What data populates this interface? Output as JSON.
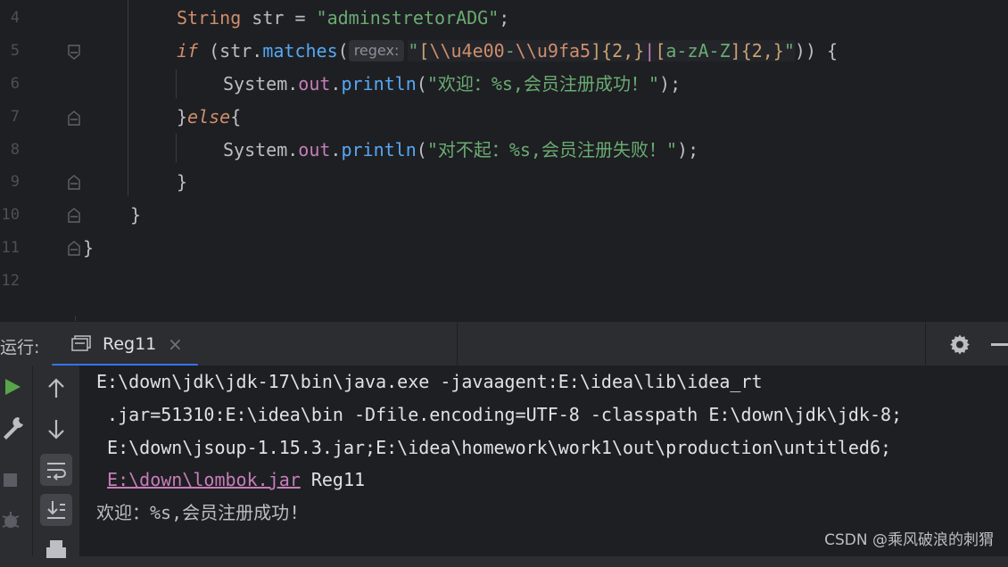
{
  "editor": {
    "line_numbers": [
      "4",
      "5",
      "6",
      "7",
      "8",
      "9",
      "10",
      "11",
      "12"
    ],
    "lines": {
      "l4": {
        "type": "String",
        "var": " str = ",
        "str": "\"adminstretorADG\"",
        "end": ";"
      },
      "l5": {
        "kw": "if",
        "open": " (str.",
        "fn": "matches",
        "paren": "(",
        "hint": "regex:",
        "q1": "\"",
        "b1": "[",
        "e1": "\\\\u4e00",
        "dash1": "-",
        "e2": "\\\\u9fa5",
        "b2": "]",
        "q2a": "{2,}",
        "or": "|",
        "b3": "[",
        "r2": "a-zA-Z",
        "b4": "]",
        "q2b": "{2,}",
        "q3": "\"",
        "close": ")) {"
      },
      "l6": {
        "cls": "System.",
        "fld": "out",
        "dot": ".",
        "fn": "println",
        "open": "(",
        "str": "\"欢迎：%s,会员注册成功！\"",
        "end": ");"
      },
      "l7": {
        "brace": "}",
        "kw": "else",
        "open": "{"
      },
      "l8": {
        "cls": "System.",
        "fld": "out",
        "dot": ".",
        "fn": "println",
        "open": "(",
        "str": "\"对不起：%s,会员注册失败！\"",
        "end": ");"
      },
      "l9": {
        "text": "}"
      },
      "l10": {
        "text": "}"
      },
      "l11": {
        "text": "}"
      }
    }
  },
  "run_panel": {
    "label": "运行:",
    "tab_label": "Reg11",
    "tab_close": "×"
  },
  "console": {
    "lines": [
      "E:\\down\\jdk\\jdk-17\\bin\\java.exe -javaagent:E:\\idea\\lib\\idea_rt",
      " .jar=51310:E:\\idea\\bin -Dfile.encoding=UTF-8 -classpath E:\\down\\jdk\\jdk-8;",
      " E:\\down\\jsoup-1.15.3.jar;E:\\idea\\homework\\work1\\out\\production\\untitled6;"
    ],
    "link": "E:\\down\\lombok.jar",
    "link_suffix": " Reg11",
    "output": "欢迎：%s,会员注册成功!"
  },
  "watermark": "CSDN @乘风破浪的刺猬",
  "colors": {
    "accent": "#3574f0",
    "keyword": "#cf8e6d",
    "string": "#6aab73",
    "function": "#56a8f5",
    "field": "#c77dbb"
  },
  "icons": [
    "fold-icon",
    "console-icon",
    "gear-icon",
    "minimize-icon",
    "run-icon",
    "wrench-icon",
    "stop-icon",
    "bug-icon",
    "arrow-up-icon",
    "arrow-down-icon",
    "soft-wrap-icon",
    "scroll-to-end-icon",
    "print-icon"
  ]
}
